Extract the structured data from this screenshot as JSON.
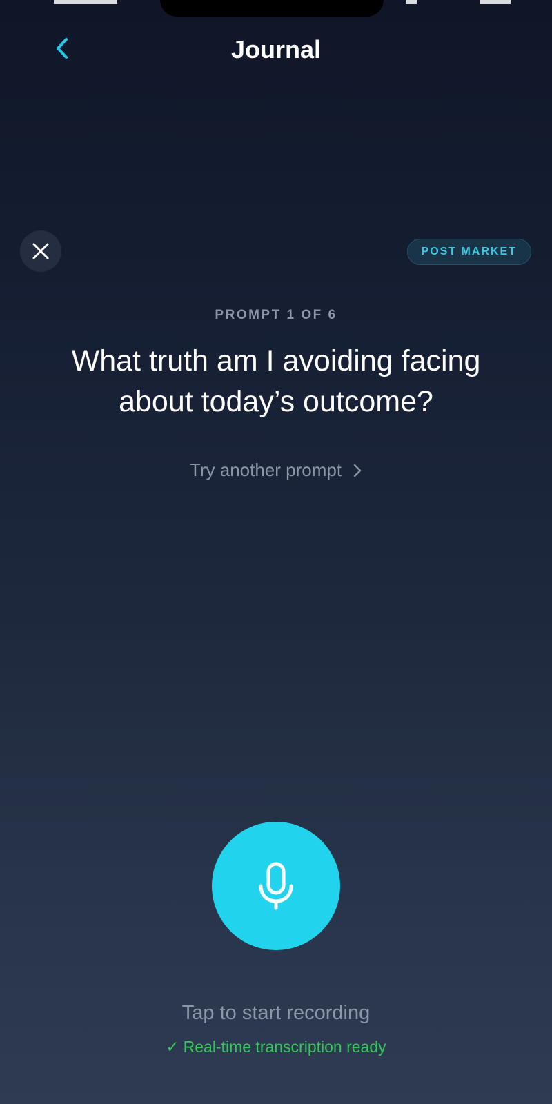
{
  "nav": {
    "title": "Journal"
  },
  "session_badge": "POST MARKET",
  "prompt": {
    "counter": "PROMPT 1 OF 6",
    "question": "What truth am I avoiding facing about today’s outcome?",
    "try_another": "Try another prompt"
  },
  "recorder": {
    "hint": "Tap to start recording",
    "status_check": "✓",
    "status": "Real-time transcription ready"
  },
  "icons": {
    "back": "chevron-left-icon",
    "close": "close-icon",
    "try_another": "chevron-right-icon",
    "mic": "microphone-icon"
  },
  "colors": {
    "accent": "#22d3ee",
    "badge_text": "#3cc8e6",
    "success": "#34c759",
    "muted_text": "#8d96a8"
  }
}
